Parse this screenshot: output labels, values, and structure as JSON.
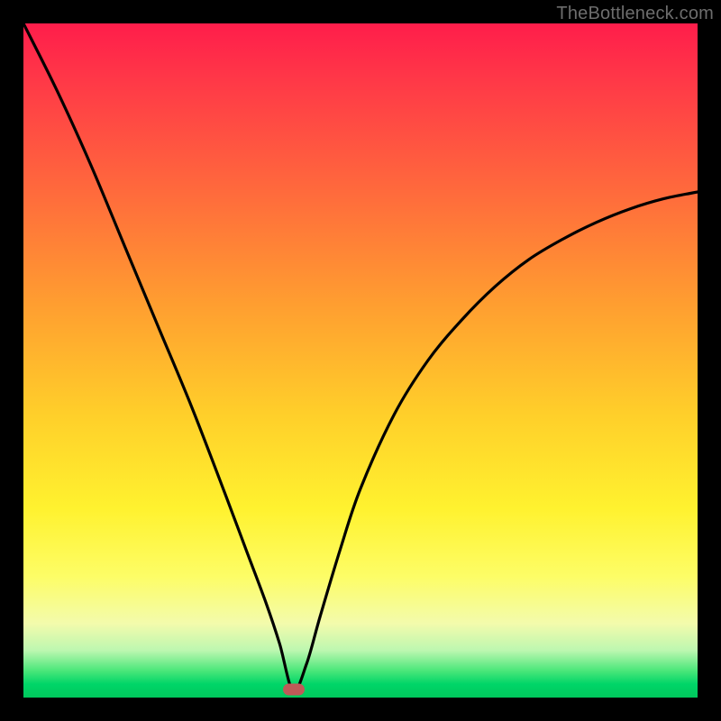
{
  "watermark": "TheBottleneck.com",
  "marker": {
    "x_pct": 40.1,
    "y_pct": 98.8
  },
  "chart_data": {
    "type": "line",
    "title": "",
    "xlabel": "",
    "ylabel": "",
    "xlim": [
      0,
      100
    ],
    "ylim": [
      0,
      100
    ],
    "series": [
      {
        "name": "bottleneck-curve",
        "x": [
          0,
          5,
          10,
          15,
          20,
          25,
          30,
          33,
          36,
          38,
          40,
          42,
          44,
          47,
          50,
          55,
          60,
          65,
          70,
          75,
          80,
          85,
          90,
          95,
          100
        ],
        "y": [
          100,
          90,
          79,
          67,
          55,
          43,
          30,
          22,
          14,
          8,
          1,
          5,
          12,
          22,
          31,
          42,
          50,
          56,
          61,
          65,
          68,
          70.5,
          72.5,
          74,
          75
        ]
      }
    ],
    "annotations": [
      {
        "name": "optimal-marker",
        "x": 40.1,
        "y": 1.2
      }
    ],
    "background_gradient": {
      "top": "#ff1d4b",
      "mid": "#fff22f",
      "bottom": "#00c85c"
    }
  }
}
